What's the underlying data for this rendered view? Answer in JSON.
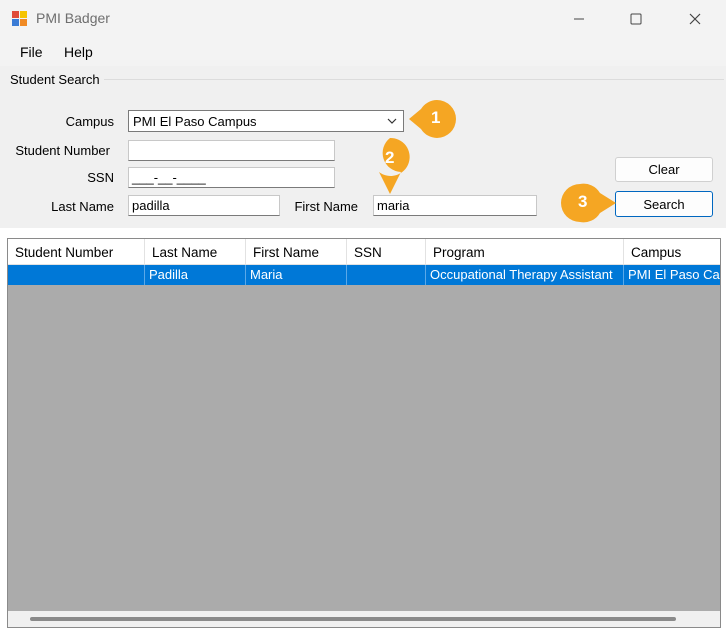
{
  "window": {
    "title": "PMI Badger",
    "icon": "app-badge-icon",
    "controls": [
      "minimize-icon",
      "maximize-icon",
      "close-icon"
    ]
  },
  "menu": {
    "items": [
      "File",
      "Help"
    ]
  },
  "search": {
    "group_title": "Student Search",
    "campus_label": "Campus",
    "campus_value": "PMI El Paso Campus",
    "student_number_label": "Student Number",
    "student_number_value": "",
    "ssn_label": "SSN",
    "ssn_value": "___-__-____",
    "last_name_label": "Last Name",
    "last_name_value": "padilla",
    "first_name_label": "First Name",
    "first_name_value": "maria",
    "clear_label": "Clear",
    "search_label": "Search"
  },
  "callouts": [
    "1",
    "2",
    "3"
  ],
  "colors": {
    "callout": "#f5a623",
    "selection": "#0078d7",
    "grid_bg": "#ababab",
    "accent": "#0067c0"
  },
  "grid": {
    "columns": [
      "Student Number",
      "Last Name",
      "First Name",
      "SSN",
      "Program",
      "Campus"
    ],
    "rows": [
      {
        "student_number": "",
        "last_name": "Padilla",
        "first_name": "Maria",
        "ssn": "",
        "program": "Occupational Therapy Assistant",
        "campus": "PMI El Paso Campus"
      }
    ]
  }
}
